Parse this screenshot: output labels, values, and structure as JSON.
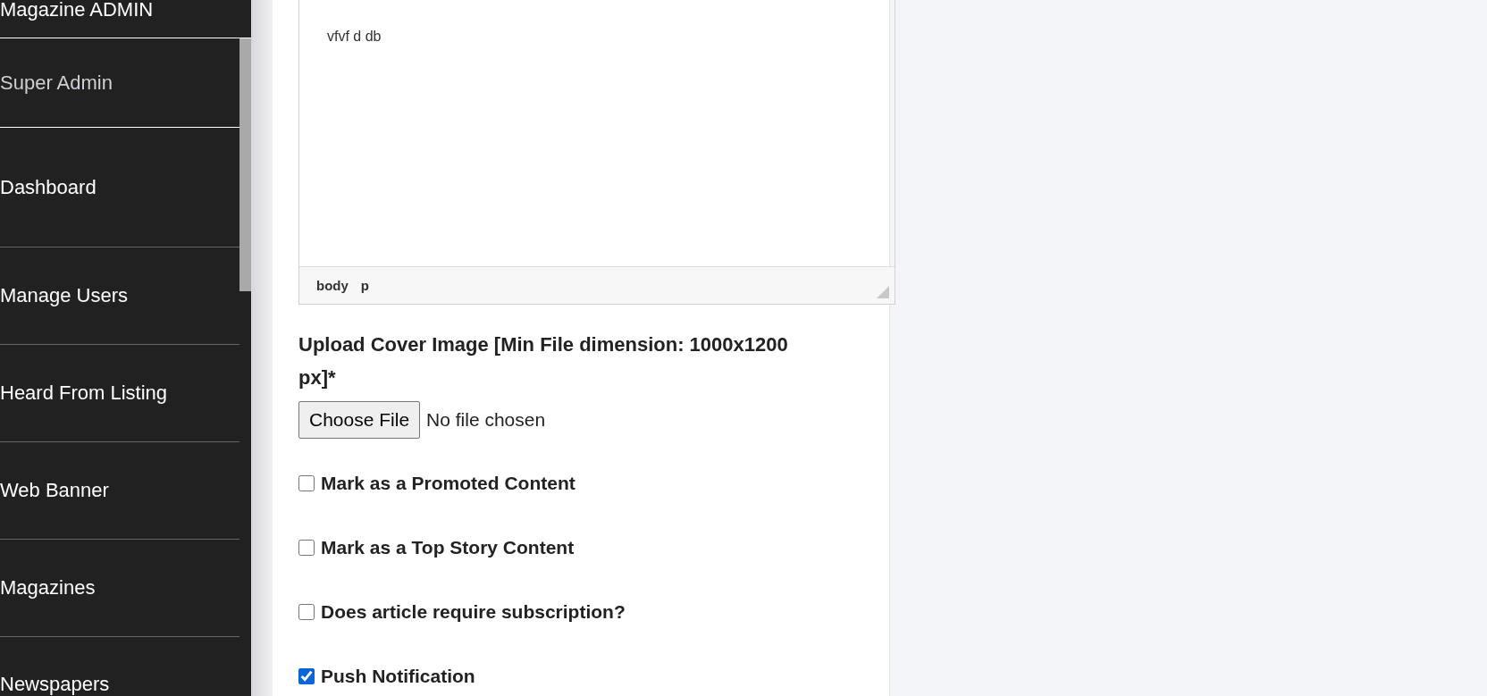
{
  "sidebar": {
    "brand": "Magazine ADMIN",
    "user": "Super Admin",
    "items": [
      {
        "label": "Dashboard"
      },
      {
        "label": "Manage Users"
      },
      {
        "label": "Heard From Listing"
      },
      {
        "label": "Web Banner"
      },
      {
        "label": "Magazines"
      },
      {
        "label": "Newspapers"
      }
    ]
  },
  "editor": {
    "content": "vfvf d db",
    "path": [
      "body",
      "p"
    ]
  },
  "upload": {
    "label": "Upload Cover Image [Min File dimension: 1000x1200 px]*",
    "button": "Choose File",
    "status": "No file chosen"
  },
  "options": [
    {
      "label": "Mark as a Promoted Content",
      "checked": false
    },
    {
      "label": "Mark as a Top Story Content",
      "checked": false
    },
    {
      "label": "Does article require subscription?",
      "checked": false
    },
    {
      "label": "Push Notification",
      "checked": true
    }
  ]
}
